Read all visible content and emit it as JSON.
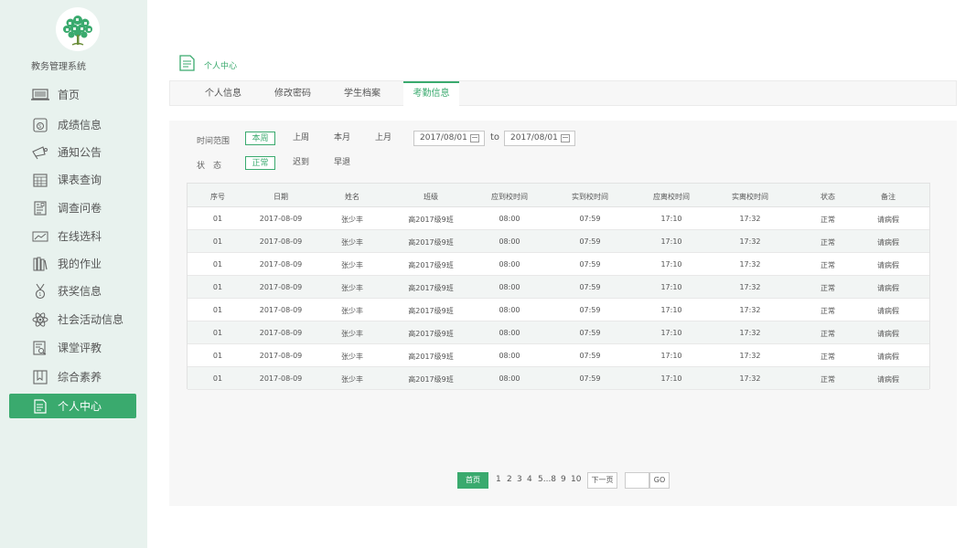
{
  "app": {
    "title": "教务管理系统"
  },
  "sidebar": {
    "items": [
      {
        "label": "首页",
        "icon": "laptop-icon"
      },
      {
        "label": "成绩信息",
        "icon": "score-icon"
      },
      {
        "label": "通知公告",
        "icon": "megaphone-icon"
      },
      {
        "label": "课表查询",
        "icon": "calendar-icon"
      },
      {
        "label": "调查问卷",
        "icon": "questionnaire-icon"
      },
      {
        "label": "在线选科",
        "icon": "chart-icon"
      },
      {
        "label": "我的作业",
        "icon": "books-icon"
      },
      {
        "label": "获奖信息",
        "icon": "medal-icon"
      },
      {
        "label": "社会活动信息",
        "icon": "atom-icon"
      },
      {
        "label": "课堂评教",
        "icon": "evaluation-icon"
      },
      {
        "label": "综合素养",
        "icon": "bookmark-icon"
      },
      {
        "label": "个人中心",
        "icon": "document-icon",
        "active": true
      }
    ]
  },
  "breadcrumb": {
    "label": "个人中心"
  },
  "tabs": [
    {
      "label": "个人信息"
    },
    {
      "label": "修改密码"
    },
    {
      "label": "学生档案"
    },
    {
      "label": "考勤信息",
      "active": true
    }
  ],
  "filters": {
    "time_label": "时间范围",
    "time_options": [
      "本周",
      "上周",
      "本月",
      "上月"
    ],
    "time_selected": "本周",
    "date_from": "2017/08/01",
    "date_to": "2017/08/01",
    "to_label": "to",
    "status_label": "状　态",
    "status_options": [
      "正常",
      "迟到",
      "早退"
    ],
    "status_selected": "正常"
  },
  "table": {
    "headers": [
      "序号",
      "日期",
      "姓名",
      "班级",
      "应到校时间",
      "实到校时间",
      "应离校时间",
      "实离校时间",
      "状态",
      "备注"
    ],
    "rows": [
      [
        "01",
        "2017-08-09",
        "张少丰",
        "高2017级9班",
        "08:00",
        "07:59",
        "17:10",
        "17:32",
        "正常",
        "请病假"
      ],
      [
        "01",
        "2017-08-09",
        "张少丰",
        "高2017级9班",
        "08:00",
        "07:59",
        "17:10",
        "17:32",
        "正常",
        "请病假"
      ],
      [
        "01",
        "2017-08-09",
        "张少丰",
        "高2017级9班",
        "08:00",
        "07:59",
        "17:10",
        "17:32",
        "正常",
        "请病假"
      ],
      [
        "01",
        "2017-08-09",
        "张少丰",
        "高2017级9班",
        "08:00",
        "07:59",
        "17:10",
        "17:32",
        "正常",
        "请病假"
      ],
      [
        "01",
        "2017-08-09",
        "张少丰",
        "高2017级9班",
        "08:00",
        "07:59",
        "17:10",
        "17:32",
        "正常",
        "请病假"
      ],
      [
        "01",
        "2017-08-09",
        "张少丰",
        "高2017级9班",
        "08:00",
        "07:59",
        "17:10",
        "17:32",
        "正常",
        "请病假"
      ],
      [
        "01",
        "2017-08-09",
        "张少丰",
        "高2017级9班",
        "08:00",
        "07:59",
        "17:10",
        "17:32",
        "正常",
        "请病假"
      ],
      [
        "01",
        "2017-08-09",
        "张少丰",
        "高2017级9班",
        "08:00",
        "07:59",
        "17:10",
        "17:32",
        "正常",
        "请病假"
      ]
    ]
  },
  "pagination": {
    "first_label": "首页",
    "pages": [
      "1",
      "2",
      "3",
      "4",
      "5...8",
      "9",
      "10"
    ],
    "next_label": "下一页",
    "go_label": "GO"
  },
  "colors": {
    "accent": "#3aaa6e",
    "sidebar_bg": "#e8f2ee"
  }
}
